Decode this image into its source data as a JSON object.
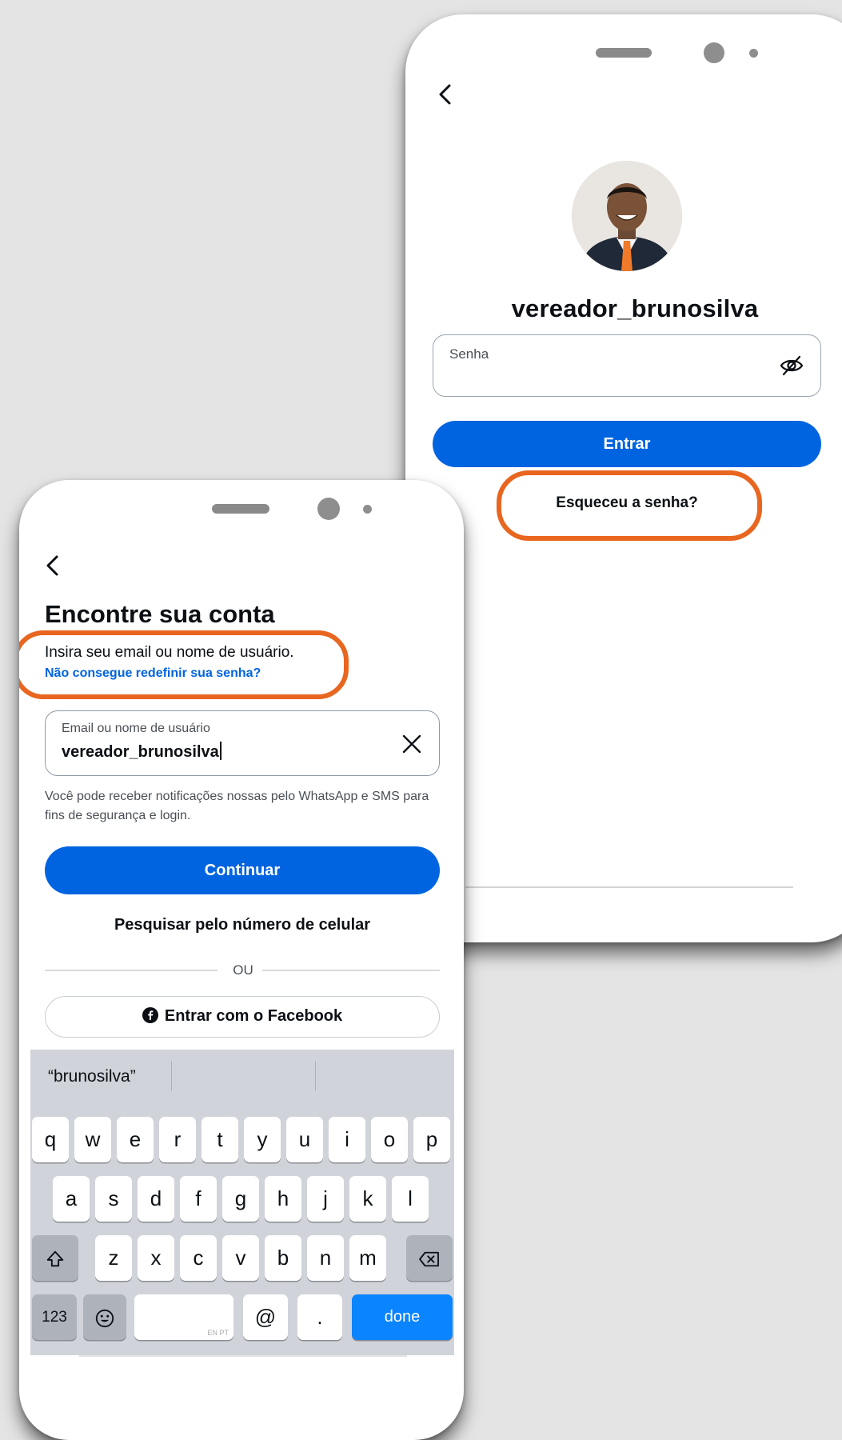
{
  "back_phone": {
    "username": "vereador_brunosilva",
    "password_label": "Senha",
    "login_button": "Entrar",
    "forgot_link": "Esqueceu a senha?"
  },
  "front_phone": {
    "title": "Encontre sua conta",
    "subtitle": "Insira seu email ou nome de usuário.",
    "cant_reset_link": "Não consegue redefinir sua senha?",
    "input_label": "Email ou nome de usuário",
    "input_value": "vereador_brunosilva",
    "notice": "Você pode receber notificações nossas pelo WhatsApp e SMS para fins de segurança e login.",
    "continue_button": "Continuar",
    "phone_search_link": "Pesquisar pelo número de celular",
    "divider": "OU",
    "facebook_button": "Entrar com o Facebook"
  },
  "keyboard": {
    "suggestion": "“brunosilva”",
    "row1": [
      "q",
      "w",
      "e",
      "r",
      "t",
      "y",
      "u",
      "i",
      "o",
      "p"
    ],
    "row2": [
      "a",
      "s",
      "d",
      "f",
      "g",
      "h",
      "j",
      "k",
      "l"
    ],
    "row3": [
      "z",
      "x",
      "c",
      "v",
      "b",
      "n",
      "m"
    ],
    "numbers_key": "123",
    "space_hint": "EN PT",
    "at_key": "@",
    "dot_key": ".",
    "done_key": "done"
  },
  "colors": {
    "brand_blue": "#0064e0",
    "highlight_orange": "#e8661f",
    "keyboard_done": "#0a84ff"
  },
  "icons": {
    "back": "chevron-left-icon",
    "eye": "eye-off-icon",
    "clear": "close-icon",
    "facebook": "facebook-icon",
    "shift": "shift-icon",
    "backspace": "backspace-icon",
    "emoji": "emoji-icon"
  }
}
